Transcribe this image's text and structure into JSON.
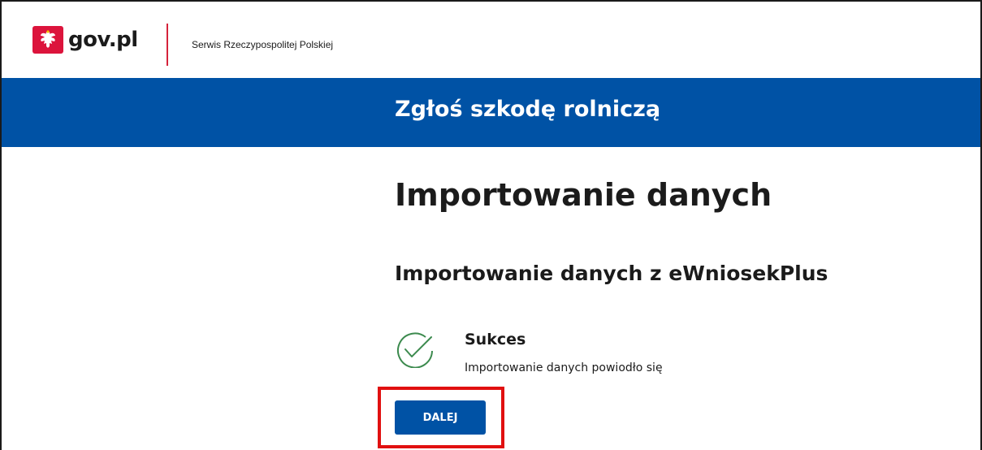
{
  "header": {
    "logo_text": "gov.pl",
    "service_name": "Serwis Rzeczypospolitej Polskiej"
  },
  "banner": {
    "title": "Zgłoś szkodę rolniczą"
  },
  "main": {
    "heading": "Importowanie danych",
    "subheading": "Importowanie danych z eWniosekPlus",
    "status": {
      "title": "Sukces",
      "message": "Importowanie danych powiodło się",
      "icon": "check-circle-icon",
      "icon_color": "#3c8a4e"
    },
    "next_button_label": "DALEJ"
  },
  "colors": {
    "brand_blue": "#0052a5",
    "brand_red": "#d5233b",
    "highlight_red": "#e11010"
  }
}
